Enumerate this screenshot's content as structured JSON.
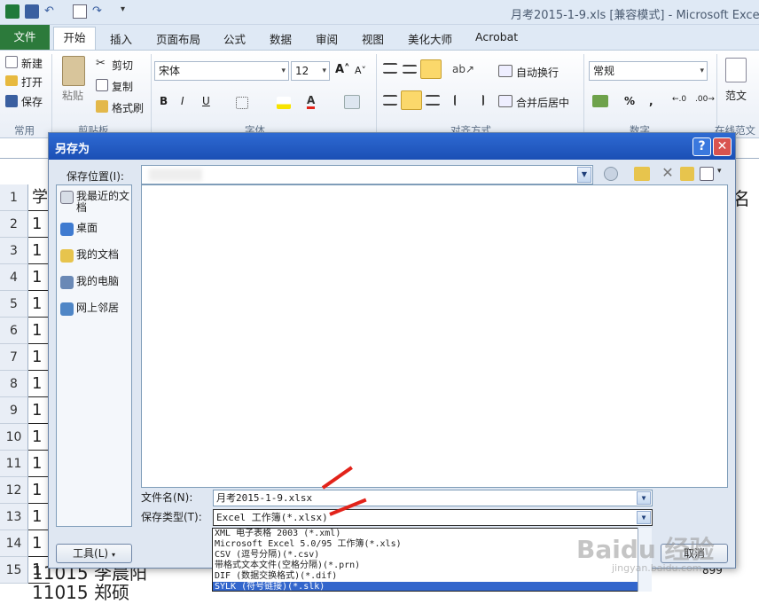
{
  "window": {
    "title": "月考2015-1-9.xls  [兼容模式]  -  Microsoft Exce"
  },
  "ribbon_tabs": [
    "文件",
    "开始",
    "插入",
    "页面布局",
    "公式",
    "数据",
    "审阅",
    "视图",
    "美化大师",
    "Acrobat"
  ],
  "clipboard": {
    "new": "新建",
    "open": "打开",
    "save": "保存",
    "paste": "粘贴",
    "cut": "剪切",
    "copy": "复制",
    "format_painter": "格式刷",
    "group_common": "常用",
    "group_label": "剪贴板"
  },
  "font": {
    "name": "宋体",
    "size": "12",
    "bold": "B",
    "italic": "I",
    "underline": "U",
    "group_label": "字体"
  },
  "alignment": {
    "wrap": "自动换行",
    "merge": "合并后居中",
    "group_label": "对齐方式"
  },
  "number": {
    "format": "常规",
    "percent": "%",
    "comma": ",",
    "group_label": "数字"
  },
  "template": {
    "label": "范文",
    "group_label": "在线范文"
  },
  "sheet": {
    "rows": [
      "1",
      "2",
      "3",
      "4",
      "5",
      "6",
      "7",
      "8",
      "9",
      "10",
      "11",
      "12",
      "13",
      "14",
      "15"
    ],
    "colA": [
      "学",
      "1",
      "1",
      "1",
      "1",
      "1",
      "1",
      "1",
      "1",
      "1",
      "1",
      "1",
      "1",
      "1",
      "1"
    ],
    "right_label": "名",
    "row15_text": "11015 李晨阳",
    "row16_text": "11015 郑硕",
    "row15_value": "899"
  },
  "dialog": {
    "title": "另存为",
    "help": "?",
    "close": "✕",
    "save_in_label": "保存位置(I):",
    "places": [
      "我最近的文档",
      "桌面",
      "我的文档",
      "我的电脑",
      "网上邻居"
    ],
    "filename_label": "文件名(N):",
    "filename_value": "月考2015-1-9.xlsx",
    "filetype_label": "保存类型(T):",
    "filetype_value": "Excel 工作簿(*.xlsx)",
    "filetype_options": [
      "XML 电子表格 2003 (*.xml)",
      "Microsoft Excel 5.0/95 工作簿(*.xls)",
      "CSV (逗号分隔)(*.csv)",
      "带格式文本文件(空格分隔)(*.prn)",
      "DIF (数据交换格式)(*.dif)",
      "SYLK (符号链接)(*.slk)"
    ],
    "tools_button": "工具(L)",
    "cancel_button": "取消"
  },
  "watermark": {
    "text": "Baidu 经验",
    "url": "jingyan.baidu.com"
  },
  "colors": {
    "file_tab": "#2c7a3b",
    "dialog_title": "#1b4fb5",
    "selection": "#3366cc",
    "annotation_arrow": "#e2231a"
  }
}
